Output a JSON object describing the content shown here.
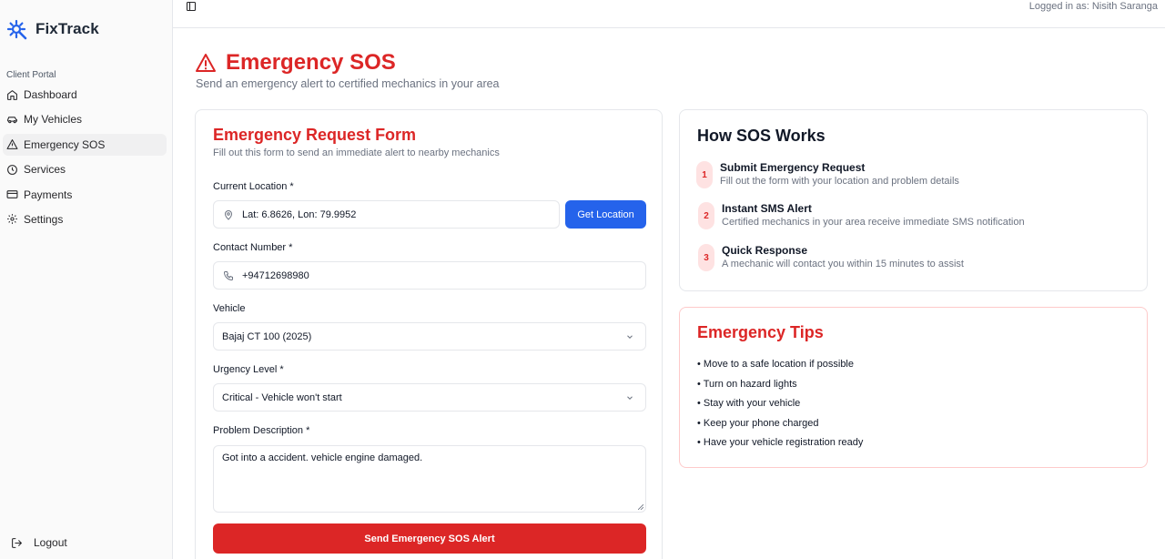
{
  "app": {
    "name": "FixTrack",
    "brand_color": "#2563eb"
  },
  "sidebar": {
    "section_label": "Client Portal",
    "items": [
      {
        "label": "Dashboard",
        "icon": "home-icon"
      },
      {
        "label": "My Vehicles",
        "icon": "car-icon"
      },
      {
        "label": "Emergency SOS",
        "icon": "alert-triangle-icon",
        "active": true
      },
      {
        "label": "Services",
        "icon": "clock-icon"
      },
      {
        "label": "Payments",
        "icon": "credit-card-icon"
      },
      {
        "label": "Settings",
        "icon": "gear-icon"
      }
    ],
    "logout_label": "Logout"
  },
  "topbar": {
    "user_text": "Logged in as: Nisith Saranga"
  },
  "header": {
    "title": "Emergency SOS",
    "subtitle": "Send an emergency alert to certified mechanics in your area",
    "accent_color": "#dc2626"
  },
  "form": {
    "title": "Emergency Request Form",
    "subtitle": "Fill out this form to send an immediate alert to nearby mechanics",
    "location_label": "Current Location *",
    "location_value": "Lat: 6.8626, Lon: 79.9952",
    "get_location_label": "Get Location",
    "contact_label": "Contact Number *",
    "contact_value": "+94712698980",
    "vehicle_label": "Vehicle",
    "vehicle_value": "Bajaj CT 100 (2025)",
    "urgency_label": "Urgency Level *",
    "urgency_value": "Critical - Vehicle won't start",
    "description_label": "Problem Description *",
    "description_value": "Got into a accident. vehicle engine damaged.",
    "submit_label": "Send Emergency SOS Alert"
  },
  "how": {
    "title": "How SOS Works",
    "steps": [
      {
        "num": "1",
        "title": "Submit Emergency Request",
        "desc": "Fill out the form with your location and problem details"
      },
      {
        "num": "2",
        "title": "Instant SMS Alert",
        "desc": "Certified mechanics in your area receive immediate SMS notification"
      },
      {
        "num": "3",
        "title": "Quick Response",
        "desc": "A mechanic will contact you within 15 minutes to assist"
      }
    ]
  },
  "tips": {
    "title": "Emergency Tips",
    "items": [
      "• Move to a safe location if possible",
      "• Turn on hazard lights",
      "• Stay with your vehicle",
      "• Keep your phone charged",
      "• Have your vehicle registration ready"
    ]
  }
}
